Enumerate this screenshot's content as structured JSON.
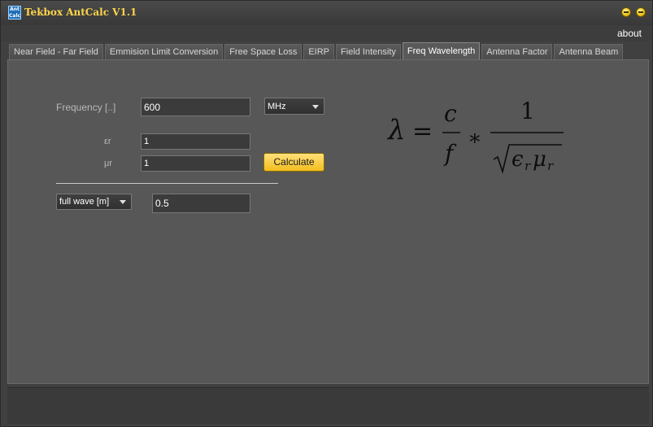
{
  "window": {
    "title": "Tekbox AntCalc V1.1",
    "icon_text": "Ant Calc"
  },
  "menu": {
    "about": "about"
  },
  "tabs": [
    {
      "label": "Near Field - Far Field",
      "active": false
    },
    {
      "label": "Emmision Limit Conversion",
      "active": false
    },
    {
      "label": "Free Space Loss",
      "active": false
    },
    {
      "label": "EIRP",
      "active": false
    },
    {
      "label": "Field Intensity",
      "active": false
    },
    {
      "label": "Freq Wavelength",
      "active": true
    },
    {
      "label": "Antenna Factor",
      "active": false
    },
    {
      "label": "Antenna Beam",
      "active": false
    }
  ],
  "form": {
    "frequency_label": "Frequency [..]",
    "frequency_value": "600",
    "unit_selected": "MHz",
    "epsilon_label": "εr",
    "epsilon_value": "1",
    "mu_label": "μr",
    "mu_value": "1",
    "calculate_label": "Calculate",
    "output_mode_selected": "full wave [m]",
    "result_value": "0.5"
  },
  "formula": {
    "lambda": "λ",
    "equals": "=",
    "c": "c",
    "f": "f",
    "times": "∗",
    "one": "1",
    "eps": "ϵ",
    "mu": "μ",
    "r": "r"
  },
  "colors": {
    "title": "#ffd54a",
    "button": "#f2be1e",
    "panel": "#575757"
  }
}
